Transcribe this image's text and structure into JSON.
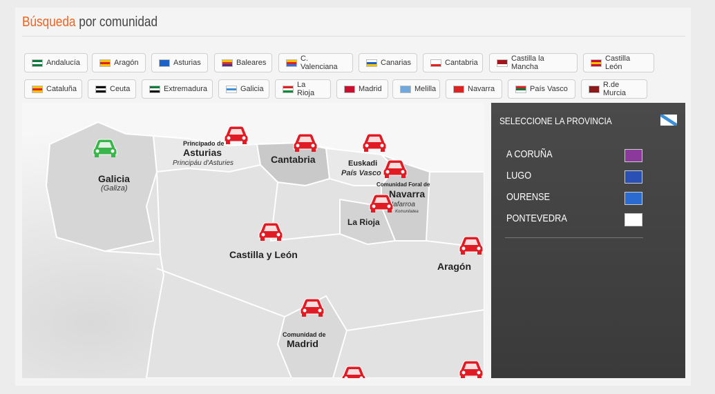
{
  "header": {
    "title_highlight": "Búsqueda",
    "title_rest": "por comunidad"
  },
  "communities": [
    {
      "label": "Andalucía",
      "flag": [
        "#0a7a3a",
        "#fff",
        "#0a7a3a"
      ]
    },
    {
      "label": "Aragón",
      "flag": [
        "#f6c200",
        "#d22",
        "#f6c200"
      ]
    },
    {
      "label": "Asturias",
      "flag": [
        "#1a62c8",
        "#1a62c8",
        "#1a62c8"
      ]
    },
    {
      "label": "Baleares",
      "flag": [
        "#f6c200",
        "#c33",
        "#5a2d82"
      ]
    },
    {
      "label": "C. Valenciana",
      "flag": [
        "#f6c200",
        "#d22",
        "#3b6bd6"
      ]
    },
    {
      "label": "Canarias",
      "flag": [
        "#fff",
        "#1a5ec8",
        "#f6c200"
      ]
    },
    {
      "label": "Cantabria",
      "flag": [
        "#fff",
        "#fff",
        "#d22"
      ]
    },
    {
      "label": "Castilla la Mancha",
      "flag": [
        "#a4141b",
        "#a4141b",
        "#fff"
      ]
    },
    {
      "label": "Castilla León",
      "flag": [
        "#c8102e",
        "#f6c200",
        "#c8102e"
      ]
    },
    {
      "label": "Cataluña",
      "flag": [
        "#f6c200",
        "#d22",
        "#f6c200"
      ]
    },
    {
      "label": "Ceuta",
      "flag": [
        "#000",
        "#fff",
        "#000"
      ]
    },
    {
      "label": "Extremadura",
      "flag": [
        "#0a7a3a",
        "#fff",
        "#111"
      ]
    },
    {
      "label": "Galicia",
      "flag": [
        "#fff",
        "#3b8fd6",
        "#fff"
      ]
    },
    {
      "label": "La Rioja",
      "flag": [
        "#d22",
        "#fff",
        "#0a8a3a"
      ]
    },
    {
      "label": "Madrid",
      "flag": [
        "#c8102e",
        "#c8102e",
        "#c8102e"
      ]
    },
    {
      "label": "Melilla",
      "flag": [
        "#6fa8dc",
        "#6fa8dc",
        "#6fa8dc"
      ]
    },
    {
      "label": "Navarra",
      "flag": [
        "#d22",
        "#d22",
        "#d22"
      ]
    },
    {
      "label": "País Vasco",
      "flag": [
        "#d22",
        "#0a7a3a",
        "#fff"
      ]
    },
    {
      "label": "R.de Murcia",
      "flag": [
        "#8a1a1a",
        "#8a1a1a",
        "#8a1a1a"
      ]
    }
  ],
  "map": {
    "regions": {
      "galicia": "Galicia",
      "galicia_sub": "(Galiza)",
      "asturias_pre": "Principado de",
      "asturias": "Asturias",
      "asturias_sub": "Principáu d'Asturies",
      "cantabria": "Cantabria",
      "euskadi": "Euskadi",
      "euskadi_sub": "País Vasco",
      "navarra_pre": "Comunidad Foral de",
      "navarra": "Navarra",
      "navarra_sub": "Nafarroa",
      "navarra_sub2": "Komunitatea",
      "rioja": "La Rioja",
      "castilla": "Castilla y León",
      "aragon": "Aragón",
      "madrid_pre": "Comunidad de",
      "madrid": "Madrid"
    },
    "colors": {
      "selected_car": "#39b54a",
      "car": "#e01b23"
    }
  },
  "sidebar": {
    "title": "SELECCIONE LA PROVINCIA",
    "provinces": [
      {
        "label": "A CORUÑA",
        "flag": "#8b3a9b"
      },
      {
        "label": "LUGO",
        "flag": "#2a4fb5"
      },
      {
        "label": "OURENSE",
        "flag": "#2b6ad0"
      },
      {
        "label": "PONTEVEDRA",
        "flag": "#ffffff"
      }
    ]
  }
}
